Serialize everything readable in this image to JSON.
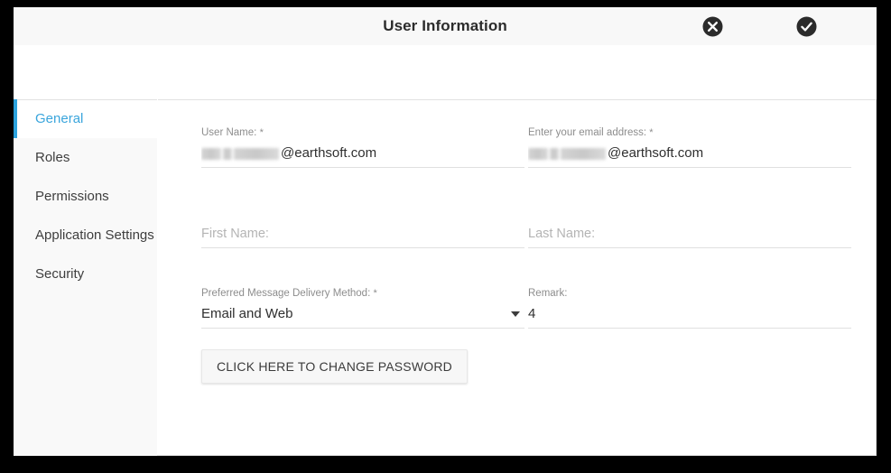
{
  "window": {
    "title": "User Information",
    "close_icon": "close-circle-icon",
    "accept_icon": "check-circle-icon"
  },
  "accent_color": "#2ca3de",
  "sidebar": {
    "items": [
      {
        "label": "General",
        "active": true
      },
      {
        "label": "Roles",
        "active": false
      },
      {
        "label": "Permissions",
        "active": false
      },
      {
        "label": "Application Settings",
        "active": false
      },
      {
        "label": "Security",
        "active": false
      }
    ]
  },
  "form": {
    "user_name": {
      "label": "User Name:",
      "required": "*",
      "value_suffix": "@earthsoft.com",
      "redacted": true
    },
    "email": {
      "label": "Enter your email address:",
      "required": "*",
      "value_suffix": "@earthsoft.com",
      "redacted": true
    },
    "first_name": {
      "label": "",
      "placeholder": "First Name:",
      "value": ""
    },
    "last_name": {
      "label": "",
      "placeholder": "Last Name:",
      "value": ""
    },
    "delivery_method": {
      "label": "Preferred Message Delivery Method:",
      "required": "*",
      "value": "Email and Web",
      "caret_icon": "chevron-down-icon"
    },
    "remark": {
      "label": "Remark:",
      "required": "",
      "value": "4"
    },
    "change_password_button": "CLICK HERE TO CHANGE PASSWORD"
  }
}
